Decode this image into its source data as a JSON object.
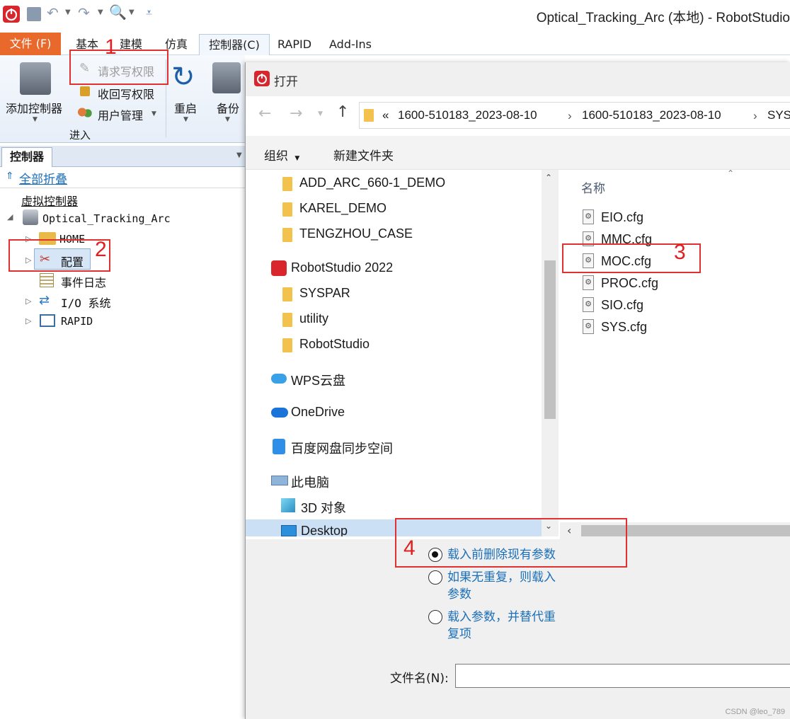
{
  "window": {
    "title": "Optical_Tracking_Arc (本地) - RobotStudio"
  },
  "ribbon": {
    "tabs": [
      "文件 (F)",
      "基本",
      "建模",
      "仿真",
      "控制器(C)",
      "RAPID",
      "Add-Ins"
    ],
    "active_tab": "控制器(C)",
    "add_controller": "添加控制器",
    "request_write": "请求写权限",
    "release_write": "收回写权限",
    "user_mgmt": "用户管理",
    "group_enter": "进入",
    "restart": "重启",
    "backup": "备份"
  },
  "panel": {
    "tab": "控制器",
    "collapse_all": "全部折叠",
    "section": "虚拟控制器",
    "root": "Optical_Tracking_Arc",
    "items": [
      "HOME",
      "配置",
      "事件日志",
      "I/O 系统",
      "RAPID"
    ]
  },
  "dialog": {
    "title": "打开",
    "breadcrumb": [
      "«",
      "1600-510183_2023-08-10",
      "1600-510183_2023-08-10",
      "SYS"
    ],
    "organize": "组织",
    "new_folder": "新建文件夹",
    "nav_items": [
      {
        "label": "ADD_ARC_660-1_DEMO",
        "icon": "folder"
      },
      {
        "label": "KAREL_DEMO",
        "icon": "folder"
      },
      {
        "label": "TENGZHOU_CASE",
        "icon": "folder"
      },
      {
        "label": "RobotStudio 2022",
        "icon": "robotstudio"
      },
      {
        "label": "SYSPAR",
        "icon": "folder"
      },
      {
        "label": "utility",
        "icon": "folder"
      },
      {
        "label": "RobotStudio",
        "icon": "folder"
      },
      {
        "label": "WPS云盘",
        "icon": "cloud"
      },
      {
        "label": "OneDrive",
        "icon": "onedrive"
      },
      {
        "label": "百度网盘同步空间",
        "icon": "baidu"
      },
      {
        "label": "此电脑",
        "icon": "pc"
      },
      {
        "label": "3D 对象",
        "icon": "3d"
      },
      {
        "label": "Desktop",
        "icon": "desktop"
      }
    ],
    "column_name": "名称",
    "files": [
      "EIO.cfg",
      "MMC.cfg",
      "MOC.cfg",
      "PROC.cfg",
      "SIO.cfg",
      "SYS.cfg"
    ],
    "options": [
      {
        "label": "载入前删除现有参数",
        "checked": true
      },
      {
        "label": "如果无重复，则载入参数",
        "checked": false
      },
      {
        "label": "载入参数，并替代重复项",
        "checked": false
      }
    ],
    "filename_label": "文件名(N):",
    "filename_value": ""
  },
  "annotations": [
    "1",
    "2",
    "3",
    "4"
  ],
  "watermark": "CSDN @leo_789",
  "colors": {
    "accent_file_tab": "#e8692b",
    "annotation_red": "#e03030",
    "link_blue": "#1b6fb8"
  }
}
